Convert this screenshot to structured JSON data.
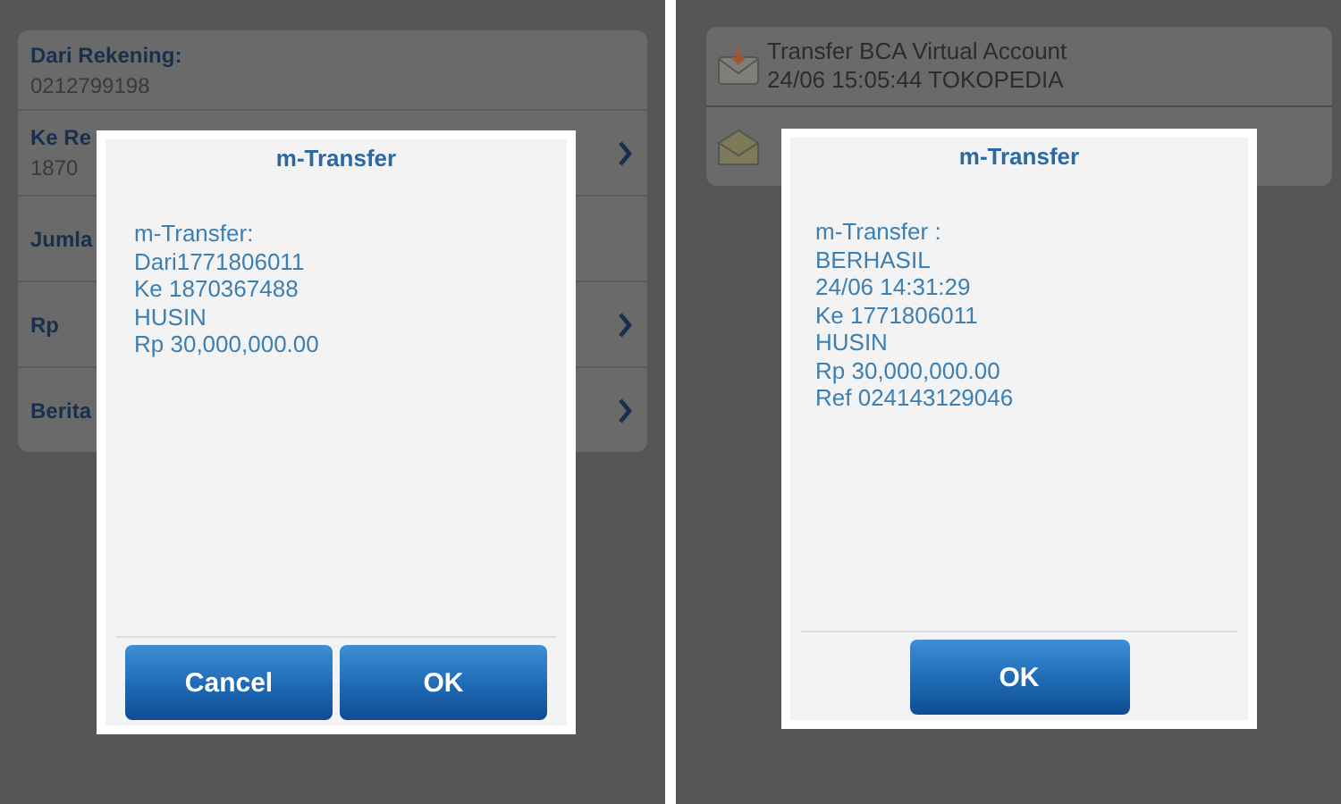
{
  "panels": [
    {
      "kind": "form",
      "rows": [
        {
          "label": "Dari Rekening:",
          "value": "0212799198",
          "chevron": false
        },
        {
          "label": "Ke Re",
          "value": "1870",
          "chevron": true
        },
        {
          "label": "Jumla",
          "chevron": false
        },
        {
          "label": "Rp",
          "chevron": true
        },
        {
          "label": "Berita",
          "chevron": true
        }
      ],
      "dialog": {
        "title": "m-Transfer",
        "lines": [
          "m-Transfer:",
          "Dari1771806011",
          "Ke 1870367488",
          "HUSIN",
          "Rp 30,000,000.00"
        ],
        "buttons": [
          "Cancel",
          "OK"
        ]
      }
    },
    {
      "kind": "history",
      "items": [
        {
          "kind": "download",
          "lines": [
            "Transfer BCA Virtual Account",
            "24/06 15:05:44 TOKOPEDIA"
          ]
        },
        {
          "kind": "mail"
        }
      ],
      "dialog": {
        "title": "m-Transfer",
        "lines": [
          "m-Transfer :",
          "BERHASIL",
          "24/06 14:31:29",
          "Ke 1771806011",
          "HUSIN",
          "Rp 30,000,000.00",
          "Ref 024143129046"
        ],
        "buttons": [
          "OK"
        ]
      }
    }
  ]
}
